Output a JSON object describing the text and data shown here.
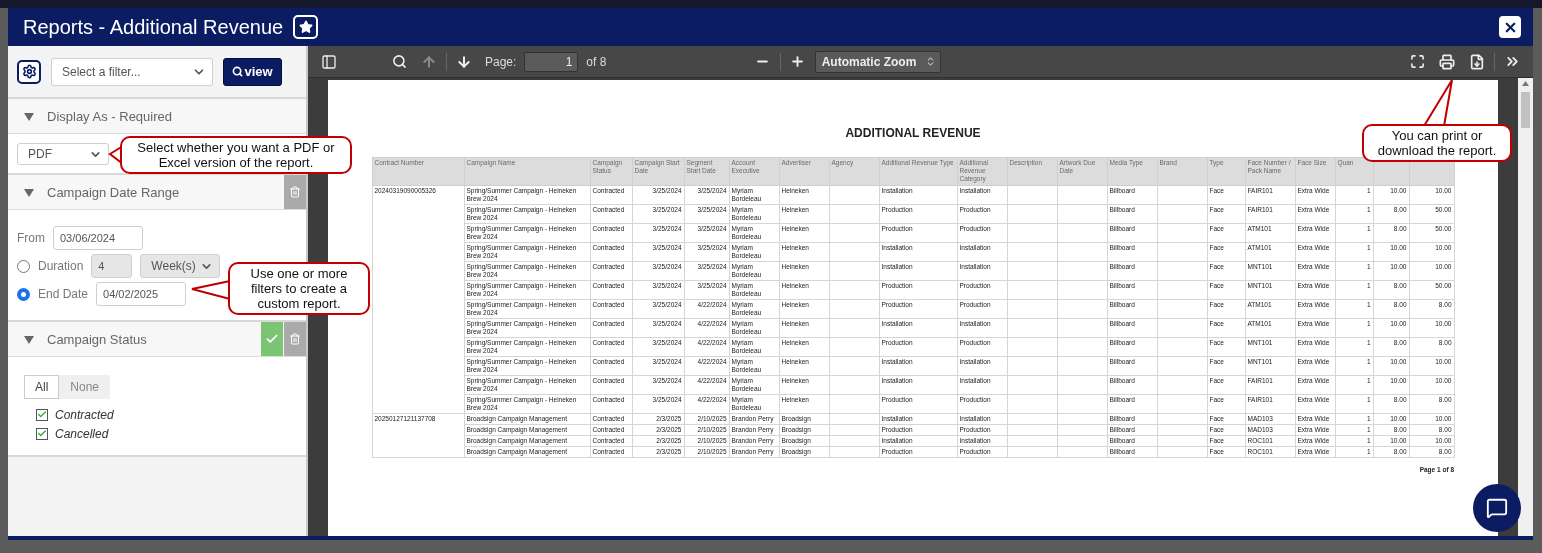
{
  "window": {
    "title": "Reports - Additional Revenue"
  },
  "filter_bar": {
    "placeholder": "Select a filter...",
    "view_button": "view"
  },
  "sections": [
    {
      "kind": "format",
      "title": "Display As - Required",
      "expanded": true,
      "value": "PDF"
    },
    {
      "kind": "date_range",
      "title": "Campaign Date Range",
      "expanded": true,
      "removable": true,
      "from_label": "From",
      "from": "03/06/2024",
      "options": [
        {
          "label": "Duration",
          "selected": false,
          "value": "4",
          "unit": "Week(s)"
        },
        {
          "label": "End Date",
          "selected": true,
          "value": "04/02/2025"
        }
      ]
    },
    {
      "kind": "status",
      "title": "Campaign Status",
      "expanded": true,
      "applied": true,
      "removable": true,
      "toggle": [
        {
          "label": "All",
          "selected": true
        },
        {
          "label": "None",
          "selected": false
        }
      ],
      "items": [
        {
          "label": "Contracted",
          "checked": true
        },
        {
          "label": "Cancelled",
          "checked": true
        }
      ]
    }
  ],
  "viewer": {
    "page_label": "Page:",
    "page": "1",
    "page_count": "of 8",
    "zoom": "Automatic Zoom"
  },
  "report": {
    "title": "ADDITIONAL REVENUE",
    "columns": [
      "Contract Number",
      "Campaign Name",
      "Campaign Status",
      "Campaign Start Date",
      "Segment Start Date",
      "Account Executive",
      "Advertiser",
      "Agency",
      "Additional Revenue Type",
      "Additional Revenue Category",
      "Description",
      "Artwork Due Date",
      "Media Type",
      "Brand",
      "Type",
      "Face Number / Pack Name",
      "Face Size",
      "Quan"
    ],
    "groups": [
      {
        "contract": "20240319090005326",
        "rows": [
          {
            "name": "Spring/Summer Campaign - Heineken Brew 2024",
            "status": "Contracted",
            "start": "3/25/2024",
            "segment": "3/25/2024",
            "executive": "Myriam Bordeleau",
            "advertiser": "Heineken",
            "revenue_type": "Installation",
            "category": "Installation",
            "media": "Billboard",
            "type": "Face",
            "face": "FAIR101",
            "size": "Extra Wide",
            "quantity": "1",
            "column_19": "10.00",
            "column_20": "10.00"
          },
          {
            "name": "Spring/Summer Campaign - Heineken Brew 2024",
            "status": "Contracted",
            "start": "3/25/2024",
            "segment": "3/25/2024",
            "executive": "Myriam Bordeleau",
            "advertiser": "Heineken",
            "revenue_type": "Production",
            "category": "Production",
            "media": "Billboard",
            "type": "Face",
            "face": "FAIR101",
            "size": "Extra Wide",
            "quantity": "1",
            "column_19": "8.00",
            "column_20": "50.00"
          },
          {
            "name": "Spring/Summer Campaign - Heineken Brew 2024",
            "status": "Contracted",
            "start": "3/25/2024",
            "segment": "3/25/2024",
            "executive": "Myriam Bordeleau",
            "advertiser": "Heineken",
            "revenue_type": "Production",
            "category": "Production",
            "media": "Billboard",
            "type": "Face",
            "face": "ATM101",
            "size": "Extra Wide",
            "quantity": "1",
            "column_19": "8.00",
            "column_20": "50.00"
          },
          {
            "name": "Spring/Summer Campaign - Heineken Brew 2024",
            "status": "Contracted",
            "start": "3/25/2024",
            "segment": "3/25/2024",
            "executive": "Myriam Bordeleau",
            "advertiser": "Heineken",
            "revenue_type": "Installation",
            "category": "Installation",
            "media": "Billboard",
            "type": "Face",
            "face": "ATM101",
            "size": "Extra Wide",
            "quantity": "1",
            "column_19": "10.00",
            "column_20": "10.00"
          },
          {
            "name": "Spring/Summer Campaign - Heineken Brew 2024",
            "status": "Contracted",
            "start": "3/25/2024",
            "segment": "3/25/2024",
            "executive": "Myriam Bordeleau",
            "advertiser": "Heineken",
            "revenue_type": "Installation",
            "category": "Installation",
            "media": "Billboard",
            "type": "Face",
            "face": "MNT101",
            "size": "Extra Wide",
            "quantity": "1",
            "column_19": "10.00",
            "column_20": "10.00"
          },
          {
            "name": "Spring/Summer Campaign - Heineken Brew 2024",
            "status": "Contracted",
            "start": "3/25/2024",
            "segment": "3/25/2024",
            "executive": "Myriam Bordeleau",
            "advertiser": "Heineken",
            "revenue_type": "Production",
            "category": "Production",
            "media": "Billboard",
            "type": "Face",
            "face": "MNT101",
            "size": "Extra Wide",
            "quantity": "1",
            "column_19": "8.00",
            "column_20": "50.00"
          },
          {
            "name": "Spring/Summer Campaign - Heineken Brew 2024",
            "status": "Contracted",
            "start": "3/25/2024",
            "segment": "4/22/2024",
            "executive": "Myriam Bordeleau",
            "advertiser": "Heineken",
            "revenue_type": "Production",
            "category": "Production",
            "media": "Billboard",
            "type": "Face",
            "face": "ATM101",
            "size": "Extra Wide",
            "quantity": "1",
            "column_19": "8.00",
            "column_20": "8.00"
          },
          {
            "name": "Spring/Summer Campaign - Heineken Brew 2024",
            "status": "Contracted",
            "start": "3/25/2024",
            "segment": "4/22/2024",
            "executive": "Myriam Bordeleau",
            "advertiser": "Heineken",
            "revenue_type": "Installation",
            "category": "Installation",
            "media": "Billboard",
            "type": "Face",
            "face": "ATM101",
            "size": "Extra Wide",
            "quantity": "1",
            "column_19": "10.00",
            "column_20": "10.00"
          },
          {
            "name": "Spring/Summer Campaign - Heineken Brew 2024",
            "status": "Contracted",
            "start": "3/25/2024",
            "segment": "4/22/2024",
            "executive": "Myriam Bordeleau",
            "advertiser": "Heineken",
            "revenue_type": "Production",
            "category": "Production",
            "media": "Billboard",
            "type": "Face",
            "face": "MNT101",
            "size": "Extra Wide",
            "quantity": "1",
            "column_19": "8.00",
            "column_20": "8.00"
          },
          {
            "name": "Spring/Summer Campaign - Heineken Brew 2024",
            "status": "Contracted",
            "start": "3/25/2024",
            "segment": "4/22/2024",
            "executive": "Myriam Bordeleau",
            "advertiser": "Heineken",
            "revenue_type": "Installation",
            "category": "Installation",
            "media": "Billboard",
            "type": "Face",
            "face": "MNT101",
            "size": "Extra Wide",
            "quantity": "1",
            "column_19": "10.00",
            "column_20": "10.00"
          },
          {
            "name": "Spring/Summer Campaign - Heineken Brew 2024",
            "status": "Contracted",
            "start": "3/25/2024",
            "segment": "4/22/2024",
            "executive": "Myriam Bordeleau",
            "advertiser": "Heineken",
            "revenue_type": "Installation",
            "category": "Installation",
            "media": "Billboard",
            "type": "Face",
            "face": "FAIR101",
            "size": "Extra Wide",
            "quantity": "1",
            "column_19": "10.00",
            "column_20": "10.00"
          },
          {
            "name": "Spring/Summer Campaign - Heineken Brew 2024",
            "status": "Contracted",
            "start": "3/25/2024",
            "segment": "4/22/2024",
            "executive": "Myriam Bordeleau",
            "advertiser": "Heineken",
            "revenue_type": "Production",
            "category": "Production",
            "media": "Billboard",
            "type": "Face",
            "face": "FAIR101",
            "size": "Extra Wide",
            "quantity": "1",
            "column_19": "8.00",
            "column_20": "8.00"
          }
        ]
      },
      {
        "contract": "20250127121137708",
        "rows": [
          {
            "name": "Broadsign Campaign Management",
            "status": "Contracted",
            "start": "2/3/2025",
            "segment": "2/10/2025",
            "executive": "Brandon  Perry",
            "advertiser": "Broadsign",
            "revenue_type": "Installation",
            "category": "Installation",
            "media": "Billboard",
            "type": "Face",
            "face": "MAD103",
            "size": "Extra Wide",
            "quantity": "1",
            "column_19": "10.00",
            "column_20": "10.00"
          },
          {
            "name": "Broadsign Campaign Management",
            "status": "Contracted",
            "start": "2/3/2025",
            "segment": "2/10/2025",
            "executive": "Brandon  Perry",
            "advertiser": "Broadsign",
            "revenue_type": "Production",
            "category": "Production",
            "media": "Billboard",
            "type": "Face",
            "face": "MAD103",
            "size": "Extra Wide",
            "quantity": "1",
            "column_19": "8.00",
            "column_20": "8.00"
          },
          {
            "name": "Broadsign Campaign Management",
            "status": "Contracted",
            "start": "2/3/2025",
            "segment": "2/10/2025",
            "executive": "Brandon  Perry",
            "advertiser": "Broadsign",
            "revenue_type": "Installation",
            "category": "Installation",
            "media": "Billboard",
            "type": "Face",
            "face": "ROC101",
            "size": "Extra Wide",
            "quantity": "1",
            "column_19": "10.00",
            "column_20": "10.00"
          },
          {
            "name": "Broadsign Campaign Management",
            "status": "Contracted",
            "start": "2/3/2025",
            "segment": "2/10/2025",
            "executive": "Brandon  Perry",
            "advertiser": "Broadsign",
            "revenue_type": "Production",
            "category": "Production",
            "media": "Billboard",
            "type": "Face",
            "face": "ROC101",
            "size": "Extra Wide",
            "quantity": "1",
            "column_19": "8.00",
            "column_20": "8.00"
          }
        ]
      }
    ],
    "footer": "Page 1 of 8"
  },
  "callouts": [
    {
      "text": "Select whether you want a PDF or Excel version of the report."
    },
    {
      "text": "Use one or more filters to create a custom report."
    },
    {
      "text": "You can print or download the report."
    }
  ]
}
